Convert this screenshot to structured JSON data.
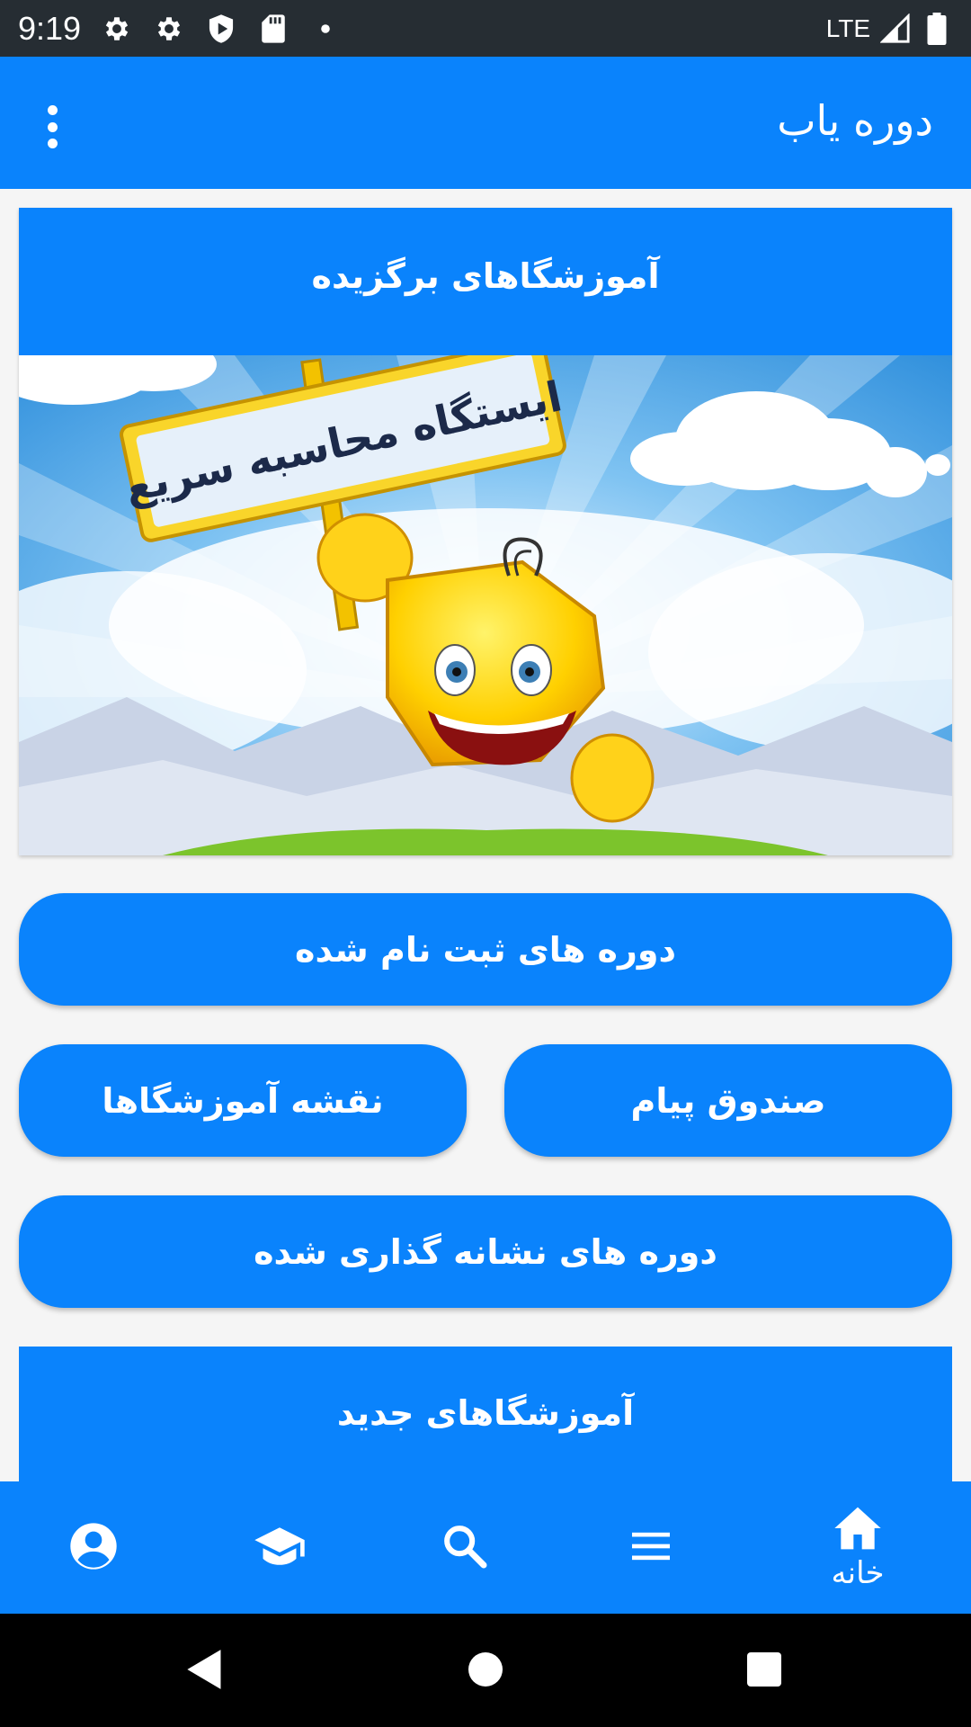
{
  "status_bar": {
    "time": "9:19",
    "network": "LTE",
    "icons": [
      "gear-icon",
      "gear-icon",
      "shield-play-icon",
      "sd-card-icon",
      "dot-icon",
      "signal-icon",
      "battery-icon"
    ]
  },
  "app_bar": {
    "title": "دوره یاب",
    "menu_icon": "more-vert-icon"
  },
  "featured": {
    "title": "آموزشگاهای برگزیده",
    "banner_text": "ایستگاه محاسبه سریع"
  },
  "buttons": {
    "enrolled_courses": "دوره های ثبت نام شده",
    "inbox": "صندوق پیام",
    "institutes_map": "نقشه آموزشگاها",
    "bookmarked_courses": "دوره های نشانه گذاری شده"
  },
  "new_institutes": {
    "title": "آموزشگاهای جدید"
  },
  "bottom_nav": {
    "items": [
      {
        "icon": "home-icon",
        "label": "خانه",
        "active": true
      },
      {
        "icon": "menu-icon"
      },
      {
        "icon": "search-icon"
      },
      {
        "icon": "graduation-cap-icon"
      },
      {
        "icon": "account-circle-icon"
      }
    ]
  },
  "colors": {
    "primary": "#0a83fc",
    "status_bar": "#262d33",
    "background": "#f5f5f5"
  }
}
